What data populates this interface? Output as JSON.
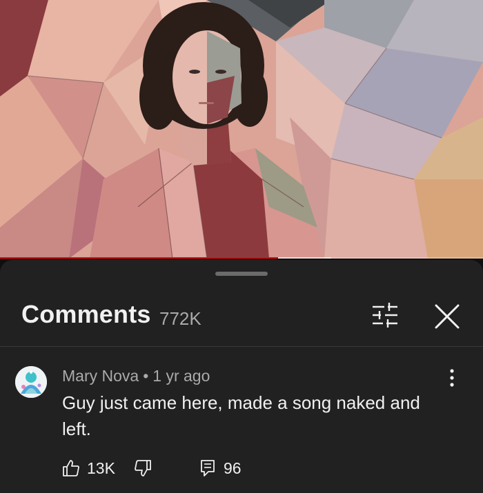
{
  "video": {
    "progress_played": 0.575,
    "progress_buffered": 0.685,
    "colors": {
      "played": "#ff0000"
    }
  },
  "comments_panel": {
    "title": "Comments",
    "count": "772K",
    "filter_icon": "sliders-icon",
    "close_icon": "close-icon"
  },
  "comment": {
    "author": "Mary Nova",
    "separator": "•",
    "time": "1 yr ago",
    "text": "Guy just came here, made a song naked and left.",
    "likes": "13K",
    "replies": "96",
    "icons": {
      "like": "thumbs-up-icon",
      "dislike": "thumbs-down-icon",
      "replies": "reply-comment-icon",
      "more": "more-vertical-icon"
    }
  }
}
